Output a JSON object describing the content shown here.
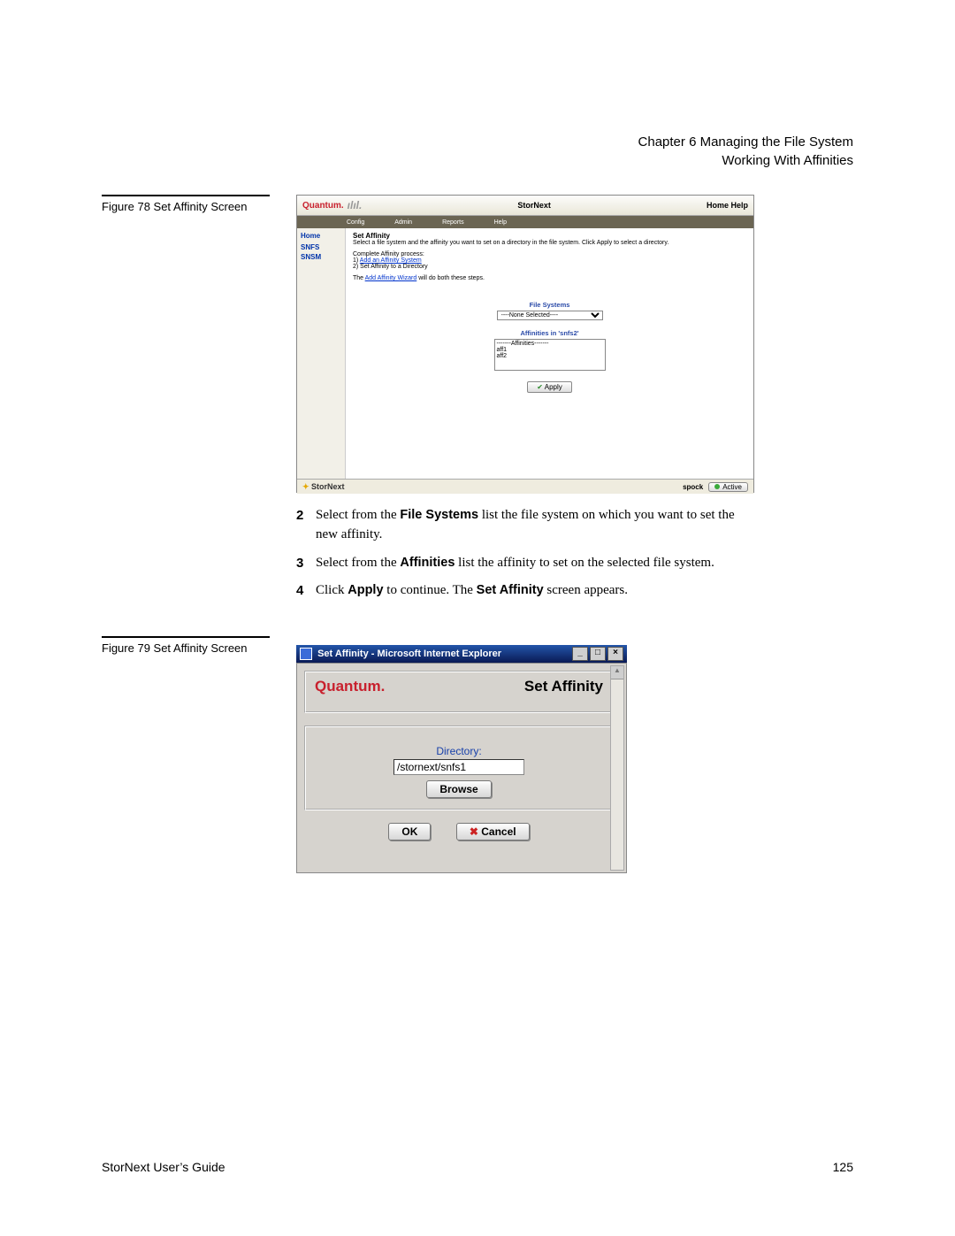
{
  "header": {
    "chapter": "Chapter 6  Managing the File System",
    "section": "Working With Affinities"
  },
  "figures": {
    "fig78_caption": "Figure 78  Set Affinity Screen",
    "fig79_caption": "Figure 79  Set Affinity Screen"
  },
  "steps": {
    "s2_num": "2",
    "s2_a": "Select from the ",
    "s2_b": "File Systems",
    "s2_c": " list the file system on which you want to set the new affinity.",
    "s3_num": "3",
    "s3_a": "Select from the ",
    "s3_b": "Affinities",
    "s3_c": " list the affinity to set on the selected file system.",
    "s4_num": "4",
    "s4_a": "Click ",
    "s4_b": "Apply",
    "s4_c": " to continue. The ",
    "s4_d": "Set Affinity",
    "s4_e": " screen appears."
  },
  "shot1": {
    "brand": "Quantum.",
    "app_title": "StorNext",
    "home_help": "Home  Help",
    "menus": [
      "Config",
      "Admin",
      "Reports",
      "Help"
    ],
    "sidebar": {
      "home": "Home",
      "snfs": "SNFS",
      "snsm": "SNSM"
    },
    "heading": "Set Affinity",
    "instr": "Select a file system and the affinity you want to set on a directory in the file system. Click Apply to select a directory.",
    "complete_label": "Complete Affinity process:",
    "step1": "1) ",
    "step1_link": "Add an Affinity System",
    "step2": "2) Set Affinity to a Directory",
    "wizard_a": "The ",
    "wizard_link": "Add Affinity Wizard",
    "wizard_b": " will do both these steps.",
    "fs_label": "File Systems",
    "fs_selected": "----None Selected----",
    "aff_label": "Affinities in 'snfs2'",
    "aff_header": "-------Affinities-------",
    "aff_items": [
      "aff1",
      "aff2"
    ],
    "apply": "Apply",
    "footer_logo": "StorNext",
    "host": "spock",
    "status": "Active"
  },
  "shot2": {
    "title": "Set Affinity - Microsoft Internet Explorer",
    "brand": "Quantum.",
    "heading": "Set Affinity",
    "dir_label": "Directory:",
    "dir_value": "/stornext/snfs1",
    "browse": "Browse",
    "ok": "OK",
    "cancel": "Cancel"
  },
  "footer": {
    "left": "StorNext User’s Guide",
    "page": "125"
  }
}
